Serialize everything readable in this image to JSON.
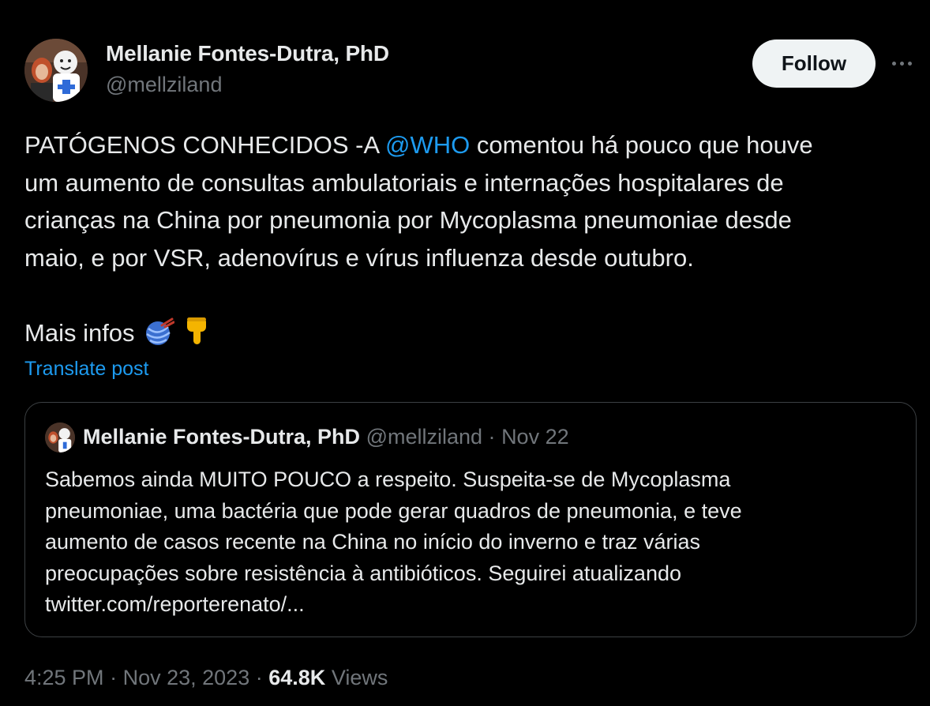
{
  "author": {
    "display_name": "Mellanie Fontes-Dutra, PhD",
    "handle": "@mellziland",
    "avatar_icon": "profile-photo-avatar"
  },
  "actions": {
    "follow_label": "Follow",
    "more_icon": "more-horizontal-icon"
  },
  "post": {
    "line1_pre": "PATÓGENOS CONHECIDOS -A ",
    "mention": "@WHO",
    "line1_post": " comentou há pouco que houve",
    "line2": "um aumento de consultas ambulatoriais e internações hospitalares de",
    "line3": "crianças na China por pneumonia por Mycoplasma pneumoniae desde",
    "line4": "maio, e por VSR, adenovírus e vírus influenza desde outubro.",
    "more_info": "Mais infos",
    "emojis": [
      "yarn-emoji",
      "pointing-down-emoji"
    ],
    "translate_label": "Translate post"
  },
  "quoted": {
    "display_name": "Mellanie Fontes-Dutra, PhD",
    "handle": "@mellziland",
    "separator": "·",
    "date": "Nov 22",
    "lines": [
      "Sabemos ainda MUITO POUCO a respeito. Suspeita-se de Mycoplasma",
      "pneumoniae, uma bactéria que pode gerar quadros de pneumonia, e teve",
      "aumento de casos recente na China no início do inverno e traz várias",
      "preocupações sobre resistência à antibióticos. Seguirei atualizando",
      "twitter.com/reporterenato/..."
    ]
  },
  "footer": {
    "time": "4:25 PM",
    "separator": "·",
    "date": "Nov 23, 2023",
    "views_count": "64.8K",
    "views_label": "Views"
  },
  "colors": {
    "background": "#000000",
    "text": "#e7e9ea",
    "muted": "#71767b",
    "accent": "#1d9bf0",
    "follow_bg": "#eff3f4"
  }
}
